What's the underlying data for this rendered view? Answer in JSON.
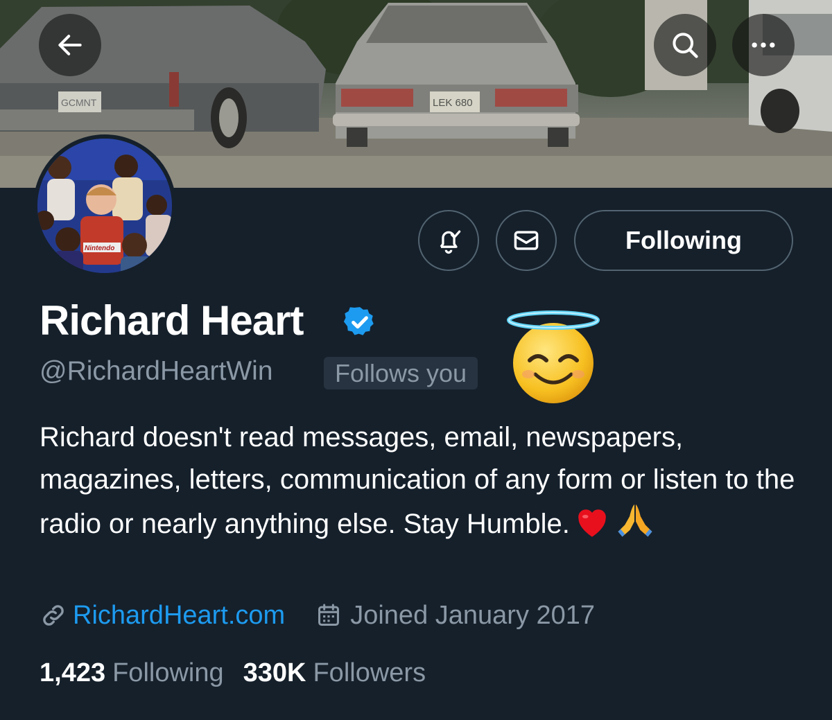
{
  "header": {
    "back_icon": "arrow-left-icon",
    "search_icon": "search-icon",
    "more_icon": "more-dots-icon",
    "banner_plate_left": "GCMNT",
    "banner_plate_center": "LEK 680"
  },
  "avatar": {
    "shirt_text": "Nintendo"
  },
  "actions": {
    "notify_icon": "bell-check-icon",
    "message_icon": "envelope-icon",
    "follow_label": "Following"
  },
  "profile": {
    "name": "Richard Heart",
    "verified": true,
    "handle": "@RichardHeartWin",
    "follows_you": "Follows you",
    "bio": "Richard doesn't read messages, email, newspapers, magazines, letters, communication of any form or listen to the radio or nearly anything else. Stay Humble.",
    "bio_emojis": [
      "red-heart",
      "folded-hands"
    ],
    "website": "RichardHeart.com",
    "joined": "Joined January 2017",
    "following_count": "1,423",
    "following_label": "Following",
    "followers_count": "330K",
    "followers_label": "Followers"
  },
  "colors": {
    "background": "#15202b",
    "accent": "#1d9bf0",
    "muted_text": "#8b98a5",
    "border": "#536471"
  }
}
